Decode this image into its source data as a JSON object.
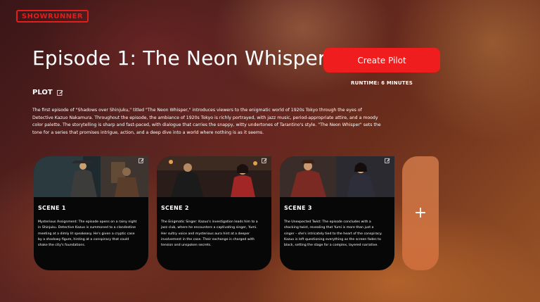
{
  "brand": {
    "logo_text": "SHOWRUNNER",
    "accent": "#e11d1d"
  },
  "episode": {
    "title": "Episode 1: The Neon Whisper",
    "create_button_label": "Create Pilot",
    "runtime": "RUNTIME: 6 MINUTES"
  },
  "plot": {
    "label": "PLOT",
    "edit_icon": "pencil-edit-icon",
    "text": "The first episode of \"Shadows over Shinjuku,\" titled \"The Neon Whisper,\" introduces viewers to the enigmatic world of 1920s Tokyo through the eyes of Detective Kazuo Nakamura. Throughout the episode, the ambiance of 1920s Tokyo is richly portrayed, with jazz music, period-appropriate attire, and a moody color palette. The storytelling is sharp and fast-paced, with dialogue that carries the snappy, witty undertones of Tarantino's style. \"The Neon Whisper\" sets the tone for a series that promises intrigue, action, and a deep dive into a world where nothing is as it seems."
  },
  "scenes": [
    {
      "title": "SCENE 1",
      "description": "Mysterious Assignment: The episode opens on a rainy night in Shinjuku. Detective Kazuo is summoned to a clandestine meeting at a dimly lit speakeasy. He's given a cryptic case by a shadowy figure, hinting at a conspiracy that could shake the city's foundations."
    },
    {
      "title": "SCENE 2",
      "description": "The Enigmatic Singer: Kazuo's investigation leads him to a jazz club, where he encounters a captivating singer, Yumi. Her sultry voice and mysterious aura hint at a deeper involvement in the case. Their exchange is charged with tension and unspoken secrets."
    },
    {
      "title": "SCENE 3",
      "description": "The Unexpected Twist: The episode concludes with a shocking twist, revealing that Yumi is more than just a singer – she's intricately tied to the heart of the conspiracy. Kazuo is left questioning everything as the screen fades to black, setting the stage for a complex, layered narrative."
    }
  ],
  "add_scene": {
    "symbol": "+"
  }
}
